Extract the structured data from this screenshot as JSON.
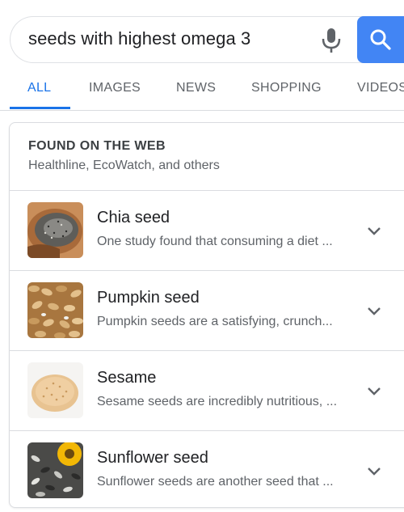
{
  "search": {
    "query": "seeds with highest omega 3",
    "mic_icon": "microphone-icon",
    "search_icon": "magnifier-icon",
    "accent_color": "#4285f4"
  },
  "tabs": [
    {
      "label": "ALL",
      "active": true
    },
    {
      "label": "IMAGES",
      "active": false
    },
    {
      "label": "NEWS",
      "active": false
    },
    {
      "label": "SHOPPING",
      "active": false
    },
    {
      "label": "VIDEOS",
      "active": false
    }
  ],
  "card": {
    "header": "FOUND ON THE WEB",
    "sources": "Healthline, EcoWatch, and others",
    "items": [
      {
        "title": "Chia seed",
        "snippet": "One study found that consuming a diet ...",
        "thumb": "chia-seed-image"
      },
      {
        "title": "Pumpkin seed",
        "snippet": "Pumpkin seeds are a satisfying, crunch...",
        "thumb": "pumpkin-seed-image"
      },
      {
        "title": "Sesame",
        "snippet": "Sesame seeds are incredibly nutritious, ...",
        "thumb": "sesame-seed-image"
      },
      {
        "title": "Sunflower seed",
        "snippet": "Sunflower seeds are another seed that ...",
        "thumb": "sunflower-seed-image"
      }
    ]
  }
}
